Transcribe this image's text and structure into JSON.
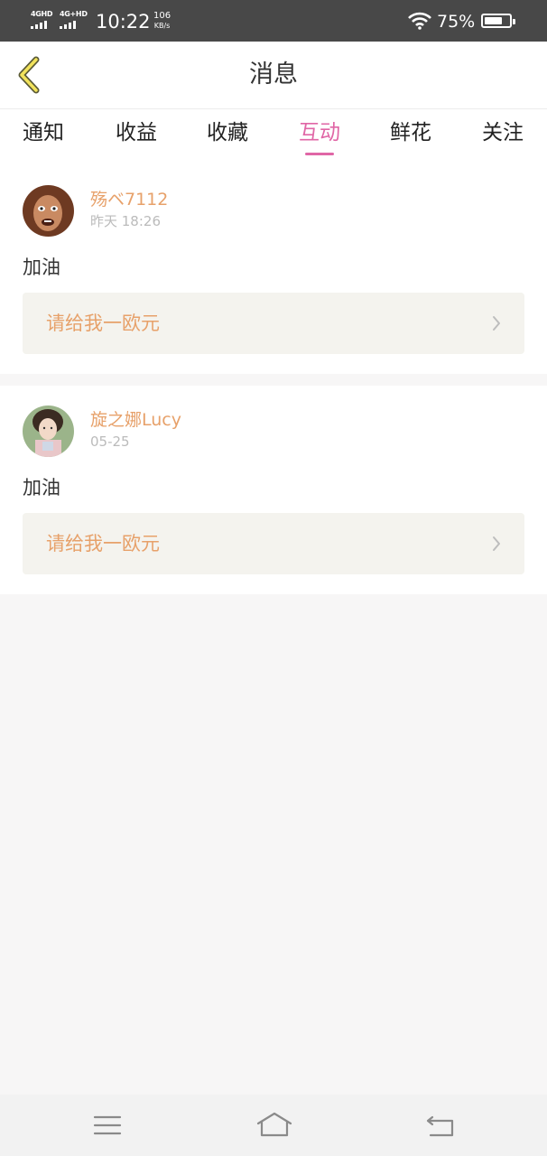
{
  "status_bar": {
    "sim1": "4GHD",
    "sim2": "4G+HD",
    "time": "10:22",
    "speed_value": "106",
    "speed_unit": "KB/s",
    "battery": "75%",
    "battery_level": 0.75
  },
  "header": {
    "title": "消息",
    "back_icon": "chevron-left-icon"
  },
  "tabs": [
    {
      "label": "通知"
    },
    {
      "label": "收益"
    },
    {
      "label": "收藏"
    },
    {
      "label": "互动"
    },
    {
      "label": "鲜花"
    },
    {
      "label": "关注"
    }
  ],
  "active_tab": "互动",
  "messages": [
    {
      "user": "殇ベ7112",
      "time": "昨天 18:26",
      "comment": "加油",
      "link": "请给我一欧元"
    },
    {
      "user": "旋之娜Lucy",
      "time": "05-25",
      "comment": "加油",
      "link": "请给我一欧元"
    }
  ],
  "colors": {
    "accent": "#e066a6",
    "username": "#e7a16a",
    "status_bar": "#484848"
  },
  "nav_icons": [
    "menu-icon",
    "home-icon",
    "back-arrow-icon"
  ]
}
